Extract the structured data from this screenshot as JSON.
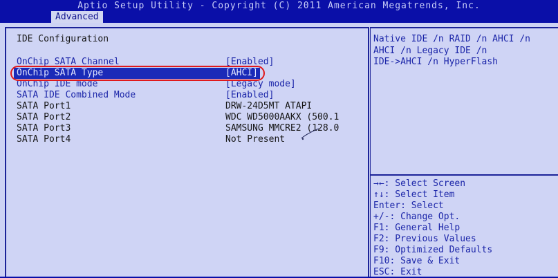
{
  "title": "Aptio Setup Utility - Copyright (C) 2011 American Megatrends, Inc.",
  "tab": "Advanced",
  "section_heading": "IDE Configuration",
  "settings": [
    {
      "label": "OnChip SATA Channel",
      "value": "[Enabled]"
    },
    {
      "label": "OnChip SATA Type",
      "value": "[AHCI]"
    },
    {
      "label": "OnChip IDE mode",
      "value": "[Legacy mode]"
    },
    {
      "label": "SATA IDE Combined Mode",
      "value": "[Enabled]"
    }
  ],
  "ports": [
    {
      "label": "SATA Port1",
      "value": "DRW-24D5MT      ATAPI"
    },
    {
      "label": "SATA Port2",
      "value": "WDC WD5000AAKX (500.1"
    },
    {
      "label": "SATA Port3",
      "value": "SAMSUNG MMCRE2 (128.0"
    },
    {
      "label": "SATA Port4",
      "value": "Not Present"
    }
  ],
  "help_lines": [
    "Native IDE /n RAID /n AHCI /n",
    "AHCI /n Legacy IDE /n",
    "IDE->AHCI /n HyperFlash"
  ],
  "nav_help": [
    "→←: Select Screen",
    "↑↓: Select Item",
    "Enter: Select",
    "+/-: Change Opt.",
    "F1: General Help",
    "F2: Previous Values",
    "F9: Optimized Defaults",
    "F10: Save & Exit",
    "ESC: Exit"
  ],
  "colors": {
    "background": "#0a0fa8",
    "panel": "#cfd4f5",
    "border": "#1b2298",
    "selection": "#1a2ab8",
    "annotation": "#e0191c",
    "option_text": "#1a24a8"
  }
}
